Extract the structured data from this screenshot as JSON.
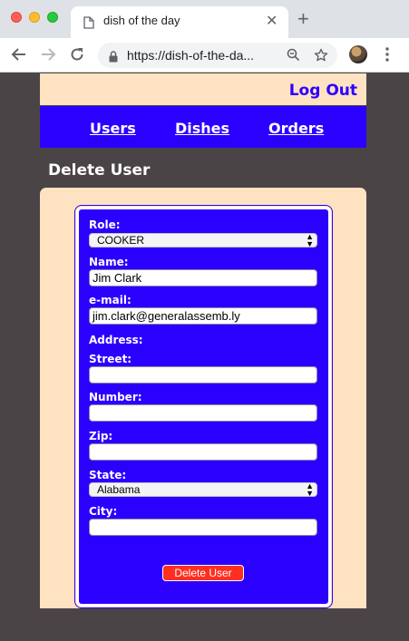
{
  "browser": {
    "tab_title": "dish of the day",
    "tab_close": "✕",
    "new_tab": "+",
    "url": "https://dish-of-the-da..."
  },
  "header": {
    "logout_label": "Log Out",
    "accent_color": "#2b00ff",
    "header_bg": "#ffe2c1"
  },
  "nav": {
    "items": [
      {
        "label": "Users"
      },
      {
        "label": "Dishes"
      },
      {
        "label": "Orders"
      }
    ]
  },
  "page": {
    "title": "Delete User"
  },
  "form": {
    "role": {
      "label": "Role:",
      "value": "COOKER"
    },
    "name": {
      "label": "Name:",
      "value": "Jim Clark"
    },
    "email": {
      "label": "e-mail:",
      "value": "jim.clark@generalassemb.ly"
    },
    "address_label": "Address:",
    "street": {
      "label": "Street:",
      "value": ""
    },
    "number": {
      "label": "Number:",
      "value": ""
    },
    "zip": {
      "label": "Zip:",
      "value": ""
    },
    "state": {
      "label": "State:",
      "value": "Alabama"
    },
    "city": {
      "label": "City:",
      "value": ""
    },
    "submit_label": "Delete User",
    "submit_color": "#ff2e1f"
  }
}
